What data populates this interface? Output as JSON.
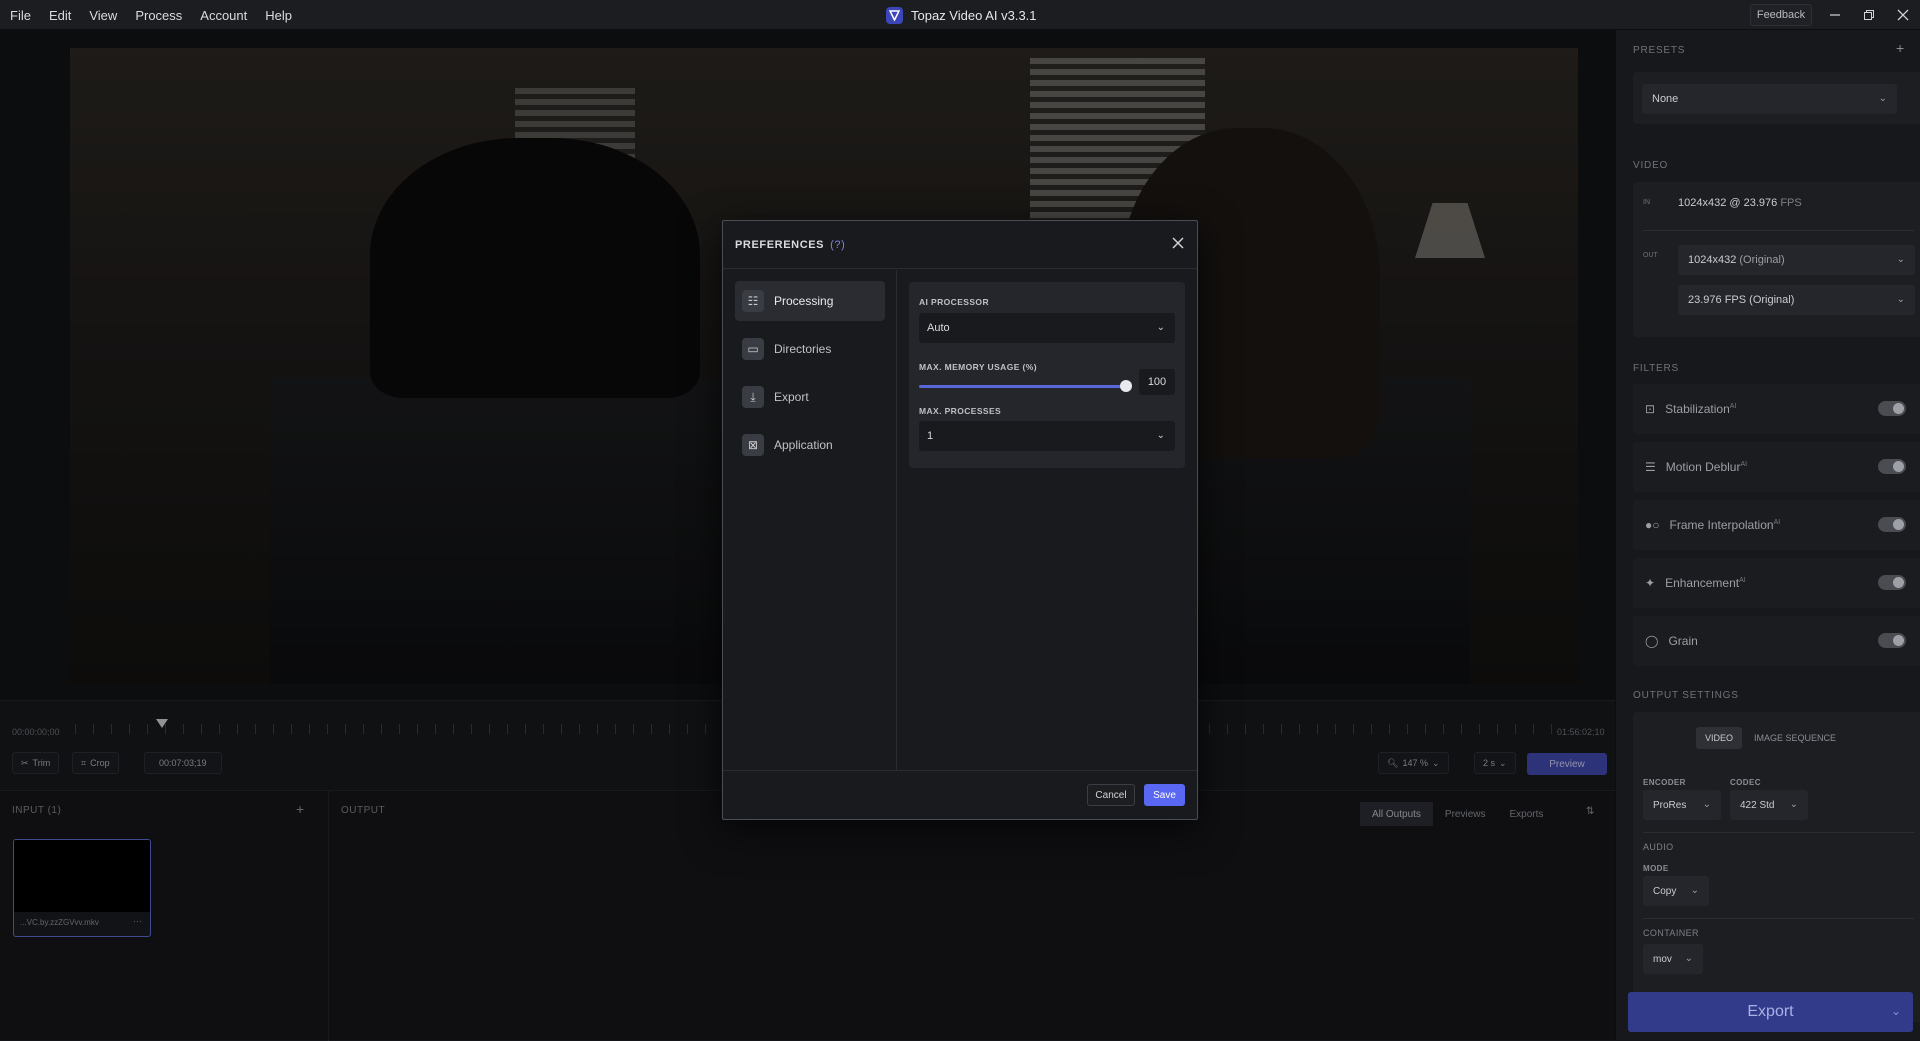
{
  "menu": [
    "File",
    "Edit",
    "View",
    "Process",
    "Account",
    "Help"
  ],
  "app": {
    "title": "Topaz Video AI  v3.3.1",
    "feedback": "Feedback"
  },
  "timeline": {
    "start": "00:00:00;00",
    "end": "01:56:02;10",
    "trim": "Trim",
    "crop": "Crop",
    "current": "00:07:03;19",
    "zoom": "147 %",
    "speed": "2 s",
    "preview": "Preview"
  },
  "input": {
    "label": "INPUT (1)",
    "file": "...VC.by.zzZGVvv.mkv",
    "more": "···"
  },
  "output": {
    "label": "OUTPUT",
    "tabs": [
      "All Outputs",
      "Previews",
      "Exports"
    ]
  },
  "sidebar": {
    "presets_label": "PRESETS",
    "preset_value": "None",
    "video_label": "VIDEO",
    "in_tag": "IN",
    "in_res": "1024x432",
    "in_fps": "23.976",
    "in_fps_unit": "FPS",
    "out_tag": "OUT",
    "out_res": "1024x432",
    "out_res_note": "(Original)",
    "out_fps": "23.976 FPS (Original)",
    "filters_label": "FILTERS",
    "filters": [
      {
        "name": "Stabilization",
        "ai": "AI",
        "icon": "stabilization-icon"
      },
      {
        "name": "Motion Deblur",
        "ai": "AI",
        "icon": "motion-deblur-icon"
      },
      {
        "name": "Frame Interpolation",
        "ai": "AI",
        "icon": "frame-interpolation-icon"
      },
      {
        "name": "Enhancement",
        "ai": "AI",
        "icon": "enhancement-icon"
      },
      {
        "name": "Grain",
        "ai": "",
        "icon": "grain-icon"
      }
    ],
    "output_settings_label": "OUTPUT SETTINGS",
    "tab_video": "VIDEO",
    "tab_image_sequence": "IMAGE SEQUENCE",
    "encoder_label": "ENCODER",
    "encoder_value": "ProRes",
    "codec_label": "CODEC",
    "codec_value": "422 Std",
    "audio_label": "AUDIO",
    "mode_label": "MODE",
    "mode_value": "Copy",
    "container_label": "CONTAINER",
    "container_value": "mov",
    "export": "Export"
  },
  "modal": {
    "title": "PREFERENCES",
    "help": "(?)",
    "nav": [
      "Processing",
      "Directories",
      "Export",
      "Application"
    ],
    "ai_processor_label": "AI PROCESSOR",
    "ai_processor_value": "Auto",
    "memory_label": "MAX. MEMORY USAGE (%)",
    "memory_value": "100",
    "memory_fraction": 1.0,
    "processes_label": "MAX. PROCESSES",
    "processes_value": "1",
    "cancel": "Cancel",
    "save": "Save"
  },
  "colors": {
    "accent": "#5a67f2",
    "export": "#323a8a"
  }
}
